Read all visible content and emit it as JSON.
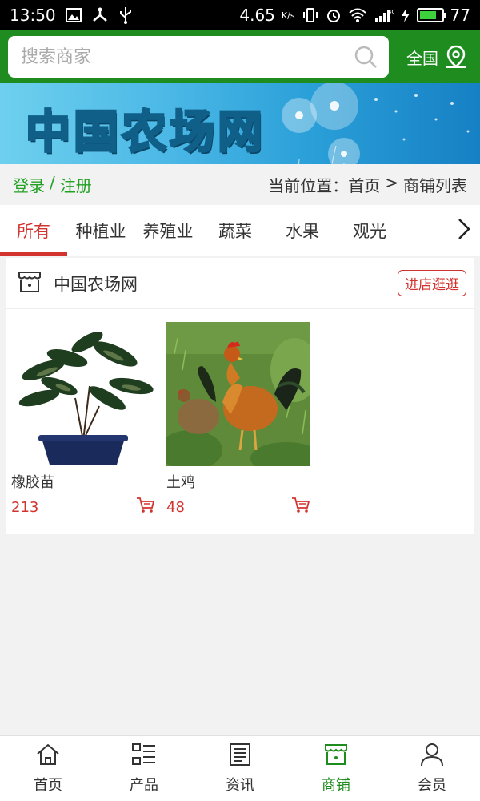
{
  "status_bar": {
    "time": "13:50",
    "speed": "4.65",
    "speed_unit": "K/s",
    "battery": "77",
    "battery_fraction": 0.77
  },
  "header": {
    "search_placeholder": "搜索商家",
    "region_label": "全国"
  },
  "banner": {
    "title": "中国农场网"
  },
  "nav_row": {
    "login": "登录",
    "separator": "/",
    "register": "注册",
    "breadcrumb_prefix": "当前位置：",
    "breadcrumb_home": "首页",
    "breadcrumb_sep": ">",
    "breadcrumb_current": "商铺列表"
  },
  "tabs": [
    {
      "label": "所有",
      "active": true
    },
    {
      "label": "种植业",
      "active": false
    },
    {
      "label": "养殖业",
      "active": false
    },
    {
      "label": "蔬菜",
      "active": false
    },
    {
      "label": "水果",
      "active": false
    },
    {
      "label": "观光",
      "active": false
    }
  ],
  "store": {
    "name": "中国农场网",
    "visit_label": "进店逛逛",
    "products": [
      {
        "name": "橡胶苗",
        "price": "213",
        "image": "rubber-plant"
      },
      {
        "name": "土鸡",
        "price": "48",
        "image": "chickens"
      }
    ]
  },
  "bottom_nav": [
    {
      "label": "首页",
      "icon": "home-icon",
      "active": false
    },
    {
      "label": "产品",
      "icon": "grid-list-icon",
      "active": false
    },
    {
      "label": "资讯",
      "icon": "news-icon",
      "active": false
    },
    {
      "label": "商铺",
      "icon": "store-icon",
      "active": true
    },
    {
      "label": "会员",
      "icon": "user-icon",
      "active": false
    }
  ],
  "colors": {
    "brand_green": "#1f8c1f",
    "accent_red": "#d2332e",
    "link_green": "#22a022"
  }
}
